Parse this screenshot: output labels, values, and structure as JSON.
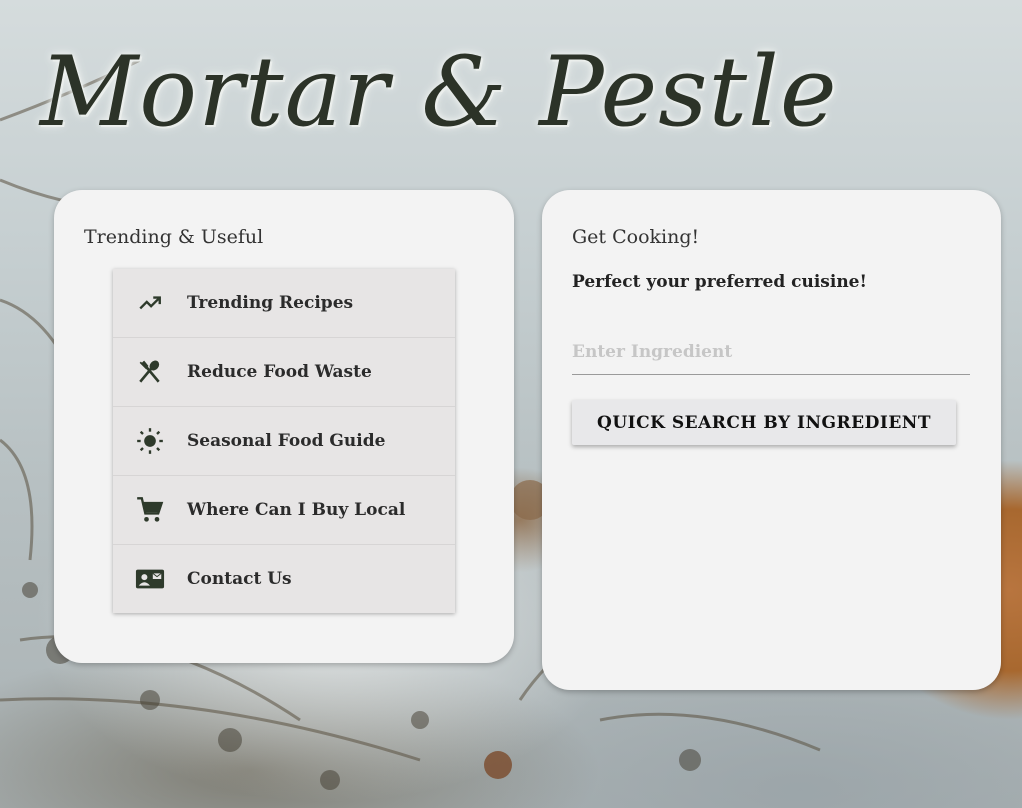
{
  "brand": {
    "logo_text": "Mortar & Pestle"
  },
  "left_card": {
    "title": "Trending & Useful",
    "items": [
      {
        "label": "Trending Recipes",
        "icon": "trending-up-icon"
      },
      {
        "label": "Reduce Food Waste",
        "icon": "utensils-icon"
      },
      {
        "label": "Seasonal Food Guide",
        "icon": "sun-icon"
      },
      {
        "label": "Where Can I Buy Local",
        "icon": "shopping-cart-icon"
      },
      {
        "label": "Contact Us",
        "icon": "contact-card-icon"
      }
    ]
  },
  "right_card": {
    "title": "Get Cooking!",
    "subtitle": "Perfect your preferred cuisine!",
    "input_placeholder": "Enter Ingredient",
    "input_value": "",
    "search_button": "QUICK SEARCH BY INGREDIENT"
  },
  "colors": {
    "card_bg": "#f3f3f3",
    "menu_bg": "#e7e5e5",
    "icon": "#2e3a2b",
    "logo": "#2c3328"
  }
}
